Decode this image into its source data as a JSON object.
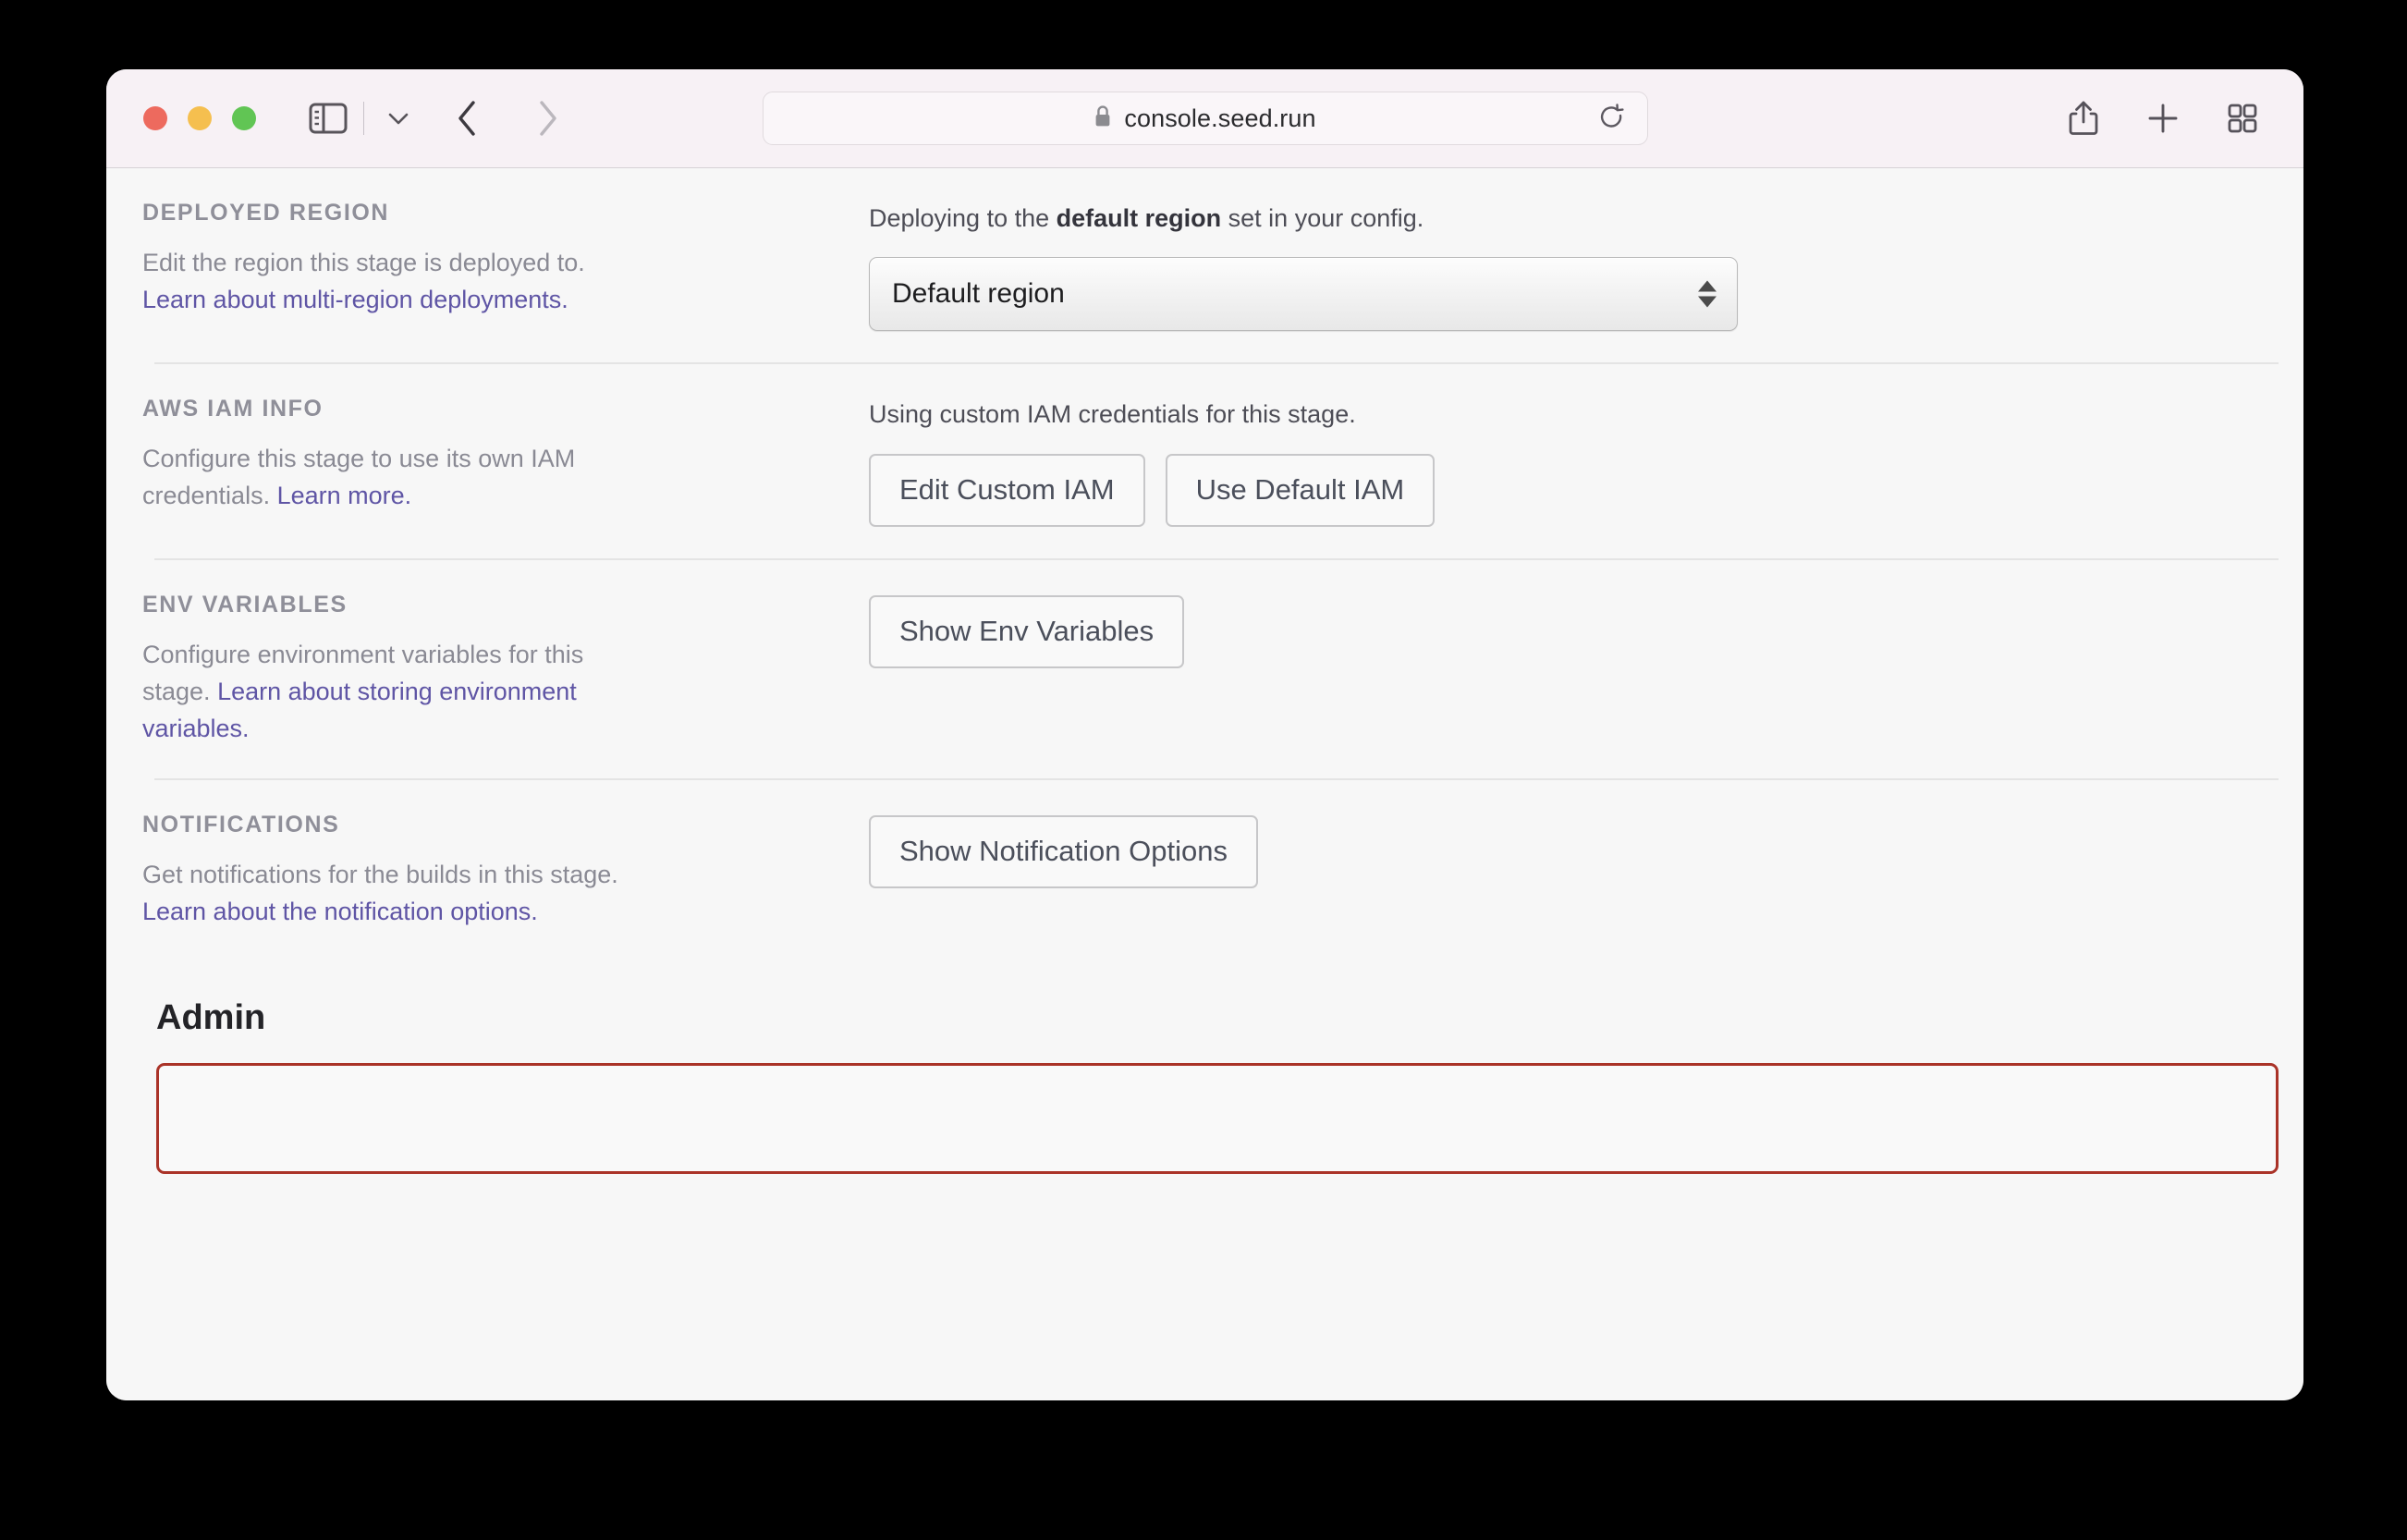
{
  "browser": {
    "url": "console.seed.run",
    "lock_icon": "lock-icon",
    "reload_icon": "reload-icon",
    "sidebar_icon": "sidebar-toggle-icon",
    "sidebar_chevron_icon": "chevron-down-icon",
    "back_icon": "chevron-left-icon",
    "forward_icon": "chevron-right-icon",
    "share_icon": "share-icon",
    "new_tab_icon": "plus-icon",
    "tab_overview_icon": "grid-icon",
    "traffic_lights": {
      "close": "close-button",
      "minimize": "minimize-button",
      "maximize": "maximize-button",
      "close_color": "#ed6a5e",
      "minimize_color": "#f5bf4f",
      "maximize_color": "#61c554"
    }
  },
  "colors": {
    "link": "#5f55a5",
    "section_label": "#8f8f99",
    "body_text": "#8a8a94",
    "button_border": "#c7c7c9",
    "button_text": "#4b4f5b",
    "admin_border": "#aa3328",
    "toolbar_bg": "#f7f1f5",
    "content_bg": "#f7f7f7"
  },
  "sections": [
    {
      "label": "DEPLOYED REGION",
      "desc_prefix": "Edit the region this stage is deployed to. ",
      "link_text": "Learn about multi-region deployments.",
      "note_prefix": "Deploying to the ",
      "note_bold": "default region",
      "note_suffix": " set in your config.",
      "select_value": "Default region"
    },
    {
      "label": "AWS IAM INFO",
      "desc_prefix": "Configure this stage to use its own IAM credentials. ",
      "link_text": "Learn more.",
      "note": "Using custom IAM credentials for this stage.",
      "buttons": [
        "Edit Custom IAM",
        "Use Default IAM"
      ]
    },
    {
      "label": "ENV VARIABLES",
      "desc_prefix": "Configure environment variables for this stage. ",
      "link_text": "Learn about storing environment variables.",
      "button": "Show Env Variables"
    },
    {
      "label": "NOTIFICATIONS",
      "desc_prefix": "Get notifications for the builds in this stage. ",
      "link_text": "Learn about the notification options.",
      "button": "Show Notification Options"
    }
  ],
  "admin": {
    "title": "Admin"
  }
}
